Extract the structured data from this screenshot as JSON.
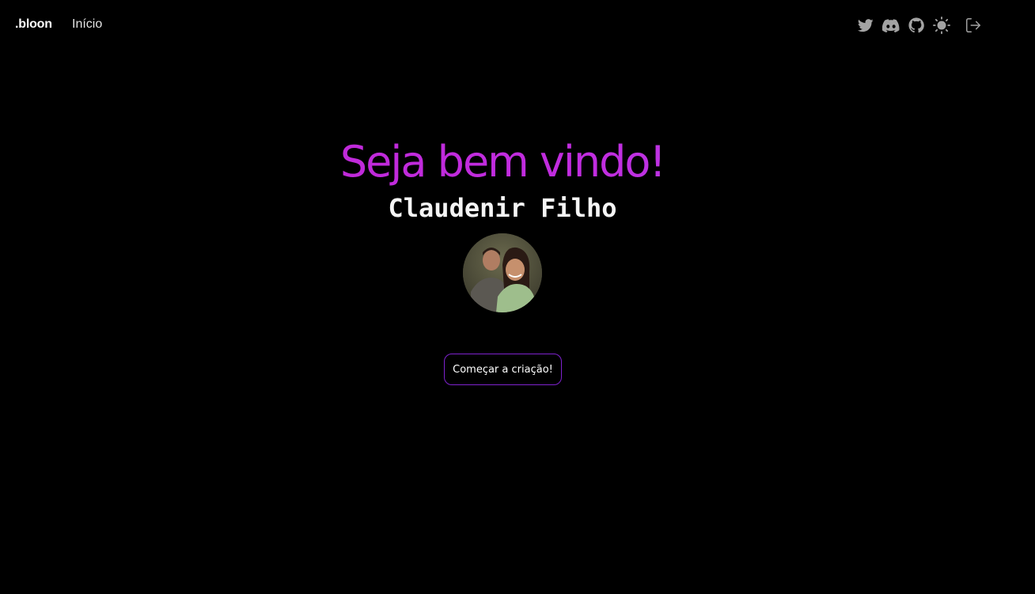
{
  "navbar": {
    "brand": ".bloon",
    "links": [
      {
        "label": "Início"
      }
    ],
    "icons": [
      {
        "name": "twitter-icon",
        "color": "#a3a3a3"
      },
      {
        "name": "discord-icon",
        "color": "#a3a3a3"
      },
      {
        "name": "github-icon",
        "color": "#a3a3a3"
      },
      {
        "name": "sun-icon",
        "color": "#a3a3a3"
      },
      {
        "name": "logout-icon",
        "color": "#a3a3a3"
      }
    ]
  },
  "hero": {
    "title": "Seja bem vindo!",
    "user_name": "Claudenir Filho",
    "avatar_icon": "user-photo",
    "cta_label": "Começar a criação!"
  },
  "colors": {
    "background": "#000000",
    "accent_gradient_start": "#c026d3",
    "accent_gradient_end": "#a855f7",
    "cta_border": "#7e22ce",
    "icon_gray": "#a3a3a3"
  }
}
